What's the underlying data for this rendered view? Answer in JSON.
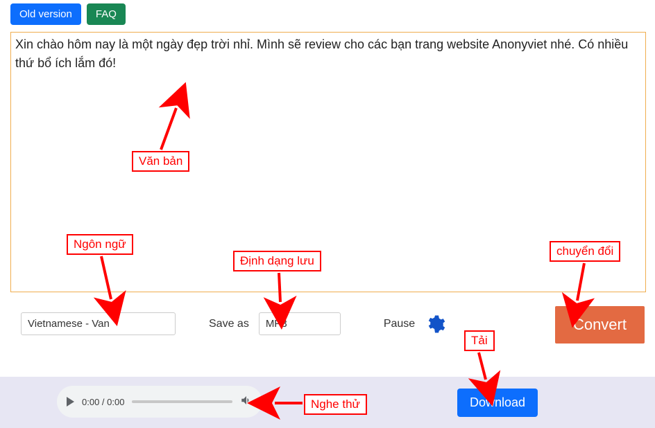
{
  "topButtons": {
    "oldVersion": "Old version",
    "faq": "FAQ"
  },
  "textarea": {
    "content": "Xin chào hôm nay là một ngày đẹp trời nhỉ. Mình sẽ review cho các bạn trang website Anonyviet nhé. Có nhiều thứ bổ ích lắm đó!"
  },
  "controls": {
    "languageValue": "Vietnamese - Van",
    "saveAsLabel": "Save as",
    "formatValue": "MP3",
    "pauseLabel": "Pause",
    "convertLabel": "Convert"
  },
  "player": {
    "time": "0:00 / 0:00",
    "downloadLabel": "Download"
  },
  "annotations": {
    "vanBan": "Văn bản",
    "ngonNgu": "Ngôn ngữ",
    "dinhDangLuu": "Định dạng lưu",
    "chuyenDoi": "chuyển đổi",
    "tai": "Tải",
    "ngheThu": "Nghe thử"
  }
}
